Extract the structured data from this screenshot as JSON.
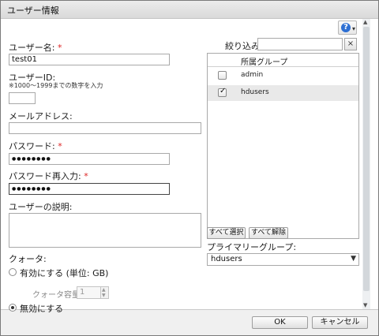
{
  "dialog": {
    "title": "ユーザー情報"
  },
  "form": {
    "username": {
      "label": "ユーザー名:",
      "required": "*",
      "value": "test01"
    },
    "userid": {
      "label": "ユーザーID:",
      "hint": "※1000～1999までの数字を入力",
      "value": ""
    },
    "email": {
      "label": "メールアドレス:",
      "value": ""
    },
    "password": {
      "label": "パスワード:",
      "required": "*",
      "value": "●●●●●●●●"
    },
    "password_confirm": {
      "label": "パスワード再入力:",
      "required": "*",
      "value": "●●●●●●●●"
    },
    "description": {
      "label": "ユーザーの説明:",
      "value": ""
    },
    "quota": {
      "label": "クォータ:",
      "enable_label": "有効にする (単位: GB)",
      "capacity_label": "クォータ容量:",
      "capacity_value": "1",
      "disable_label": "無効にする"
    }
  },
  "groups": {
    "filter_label": "絞り込み:",
    "filter_value": "",
    "clear_label": "×",
    "column_header": "所属グループ",
    "rows": [
      {
        "name": "admin",
        "checked": false
      },
      {
        "name": "hdusers",
        "checked": true
      }
    ],
    "select_all_label": "すべて選択",
    "deselect_all_label": "すべて解除",
    "primary_label": "プライマリーグループ:",
    "primary_value": "hdusers"
  },
  "footer": {
    "ok_label": "OK",
    "cancel_label": "キャンセル"
  },
  "icons": {
    "help": "help-icon",
    "dropdown": "chevron-down-icon",
    "check": "check-icon"
  },
  "colors": {
    "required": "#dd2222",
    "help": "#2d6fd3"
  }
}
